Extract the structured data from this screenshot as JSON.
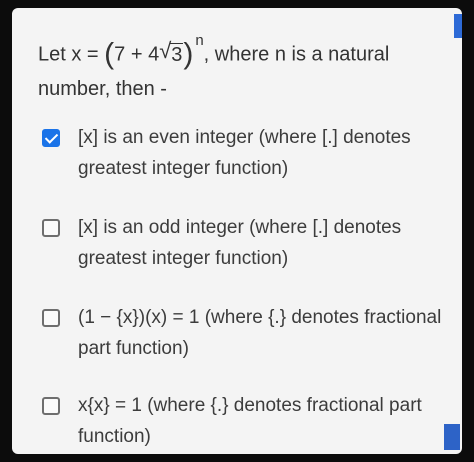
{
  "question": {
    "lead": "Let x = ",
    "paren_open": "(",
    "term": "7 + 4",
    "radicand": "3",
    "paren_close": ")",
    "exponent": "n",
    "tail": ", where n is a natural number, then -"
  },
  "options": [
    {
      "text": "[x] is an even integer (where [.] denotes greatest integer function)",
      "checked": true
    },
    {
      "text": "[x] is an odd integer (where [.] denotes greatest integer function)",
      "checked": false
    },
    {
      "text": "(1 − {x})(x) = 1  (where {.} denotes fractional part function)",
      "checked": false
    },
    {
      "text": "x{x} = 1  (where {.} denotes fractional part function)",
      "checked": false
    }
  ],
  "colors": {
    "accent": "#1a73e8",
    "card": "#f4f4f4"
  },
  "icons": {
    "checked": "checkbox-checked-icon",
    "unchecked": "checkbox-empty-icon"
  }
}
